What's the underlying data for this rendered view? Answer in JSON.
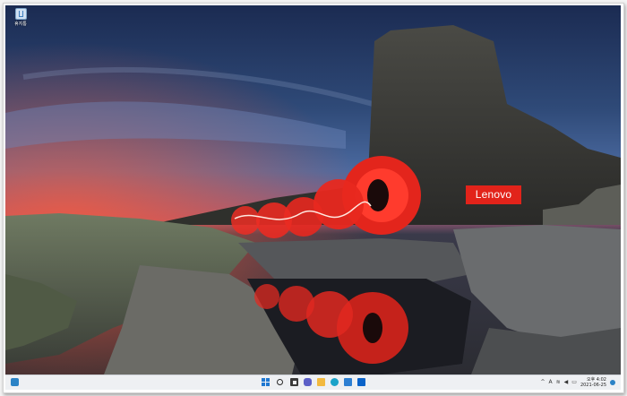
{
  "desktop": {
    "recycle_bin_label": "휴지통",
    "brand_logo_text": "Lenovo"
  },
  "taskbar": {
    "pinned_icons": [
      "widgets-icon",
      "start-icon",
      "search-icon",
      "task-view-icon",
      "chat-icon",
      "file-explorer-icon",
      "edge-icon",
      "store-icon",
      "mail-icon"
    ],
    "tray": {
      "chevron": "^",
      "language": "A",
      "time": "오후 4:02",
      "date": "2021-06-25"
    }
  },
  "colors": {
    "lenovo_red": "#e2231a",
    "taskbar_bg": "#eef0f3",
    "start_blue": "#1f78d1"
  }
}
